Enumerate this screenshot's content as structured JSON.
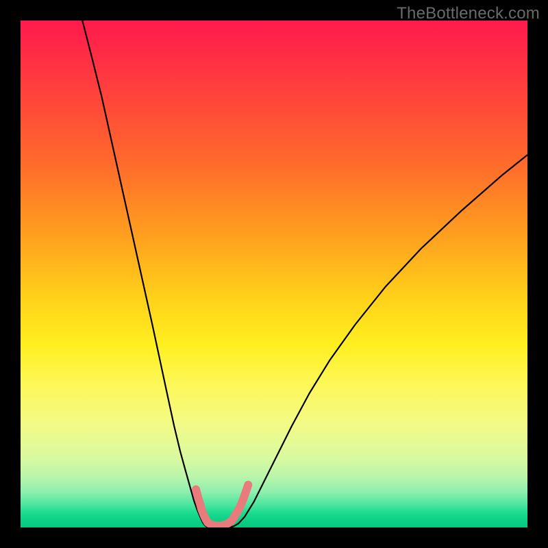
{
  "watermark": "TheBottleneck.com",
  "colors": {
    "frame": "#000000",
    "curve_stroke": "#000000",
    "bump_stroke": "#e97b7d",
    "gradient_top": "#ff1a4d",
    "gradient_bottom": "#07c87f"
  },
  "chart_data": {
    "type": "line",
    "title": "",
    "xlabel": "",
    "ylabel": "",
    "xlim": [
      0,
      100
    ],
    "ylim": [
      0,
      100
    ],
    "grid": false,
    "legend": false,
    "series": [
      {
        "name": "left-curve",
        "x": [
          12.2,
          14,
          16,
          18,
          20,
          22,
          24,
          26,
          27.5,
          29,
          30.3,
          31.5,
          32.6,
          33.5,
          34.2,
          34.8,
          35.3,
          35.7,
          36.0,
          36.3,
          36.6
        ],
        "y": [
          100,
          93,
          85,
          76,
          67,
          58,
          49,
          40,
          33,
          26,
          20,
          15,
          11,
          7.8,
          5.3,
          3.6,
          2.4,
          1.5,
          0.9,
          0.5,
          0.2
        ]
      },
      {
        "name": "floor",
        "x": [
          36.6,
          37.6,
          38.6,
          39.6,
          40.4,
          41.2,
          42.0
        ],
        "y": [
          0.2,
          0.05,
          0.02,
          0.02,
          0.05,
          0.1,
          0.2
        ]
      },
      {
        "name": "right-curve",
        "x": [
          42.0,
          43,
          44.2,
          46,
          48,
          50.5,
          53.5,
          57,
          61,
          66,
          72,
          79,
          87,
          95,
          100
        ],
        "y": [
          0.2,
          0.8,
          2.1,
          5,
          9,
          14,
          20,
          26.5,
          33,
          40,
          47.5,
          55,
          62.5,
          69.5,
          73.5
        ]
      }
    ],
    "bumps": [
      {
        "name": "left-bump",
        "x": [
          34.6,
          35.0,
          35.4,
          35.7,
          36.0,
          36.3,
          36.6,
          36.9
        ],
        "y": [
          7.5,
          6.0,
          4.7,
          3.6,
          2.8,
          2.1,
          1.5,
          1.0
        ]
      },
      {
        "name": "floor-bump",
        "x": [
          36.9,
          37.6,
          38.3,
          39.0,
          39.7,
          40.4,
          41.1,
          41.8,
          42.4
        ],
        "y": [
          1.0,
          0.55,
          0.35,
          0.3,
          0.35,
          0.55,
          0.9,
          1.5,
          2.5
        ]
      },
      {
        "name": "right-bump",
        "x": [
          42.4,
          42.9,
          43.4,
          43.9,
          44.4,
          44.9
        ],
        "y": [
          2.5,
          3.3,
          4.3,
          5.5,
          6.9,
          8.4
        ]
      }
    ]
  }
}
